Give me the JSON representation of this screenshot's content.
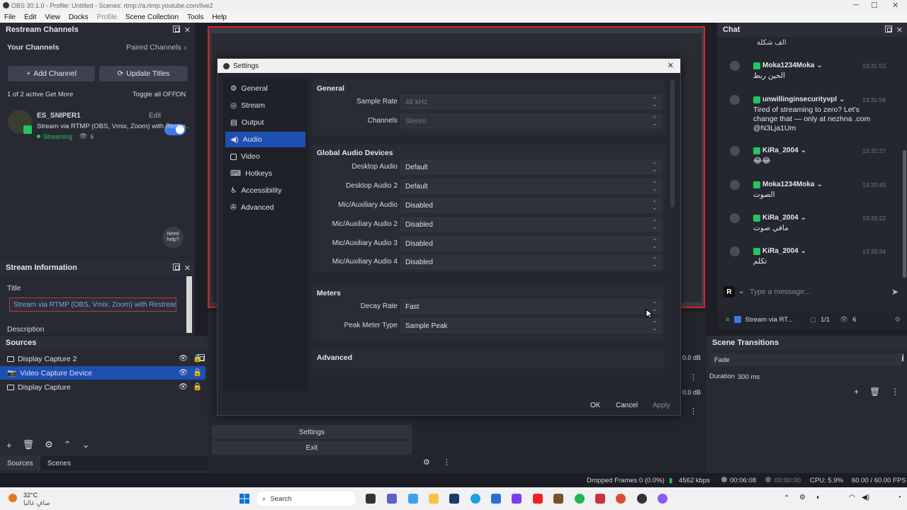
{
  "window": {
    "title": "OBS 30.1.0 - Profile: Untitled - Scenes: rtmp://a.rtmp.youtube.com/live2"
  },
  "menu": [
    "File",
    "Edit",
    "View",
    "Docks",
    "Profile",
    "Scene Collection",
    "Tools",
    "Help"
  ],
  "restream": {
    "header": "Restream Channels",
    "your_channels": "Your Channels",
    "paired_channels": "Paired Channels",
    "add_channel": "Add Channel",
    "update_titles": "Update Titles",
    "active_info": "1 of 2 active Get More",
    "toggle_all": "Toggle all OFF",
    "on": "ON",
    "channel": {
      "name": "ES_SNIPER1",
      "edit": "Edit",
      "desc": "Stream via RTMP (OBS, Vmix, Zoom) with Restre...",
      "status": "Streaming",
      "viewers": "6"
    },
    "help": "Need help?"
  },
  "stream_info": {
    "header": "Stream Information",
    "title_label": "Title",
    "title_value": "Stream via RTMP (OBS, Vmix, Zoom) with Restream",
    "description_label": "Description"
  },
  "sources": {
    "header": "Sources",
    "items": [
      {
        "name": "Display Capture 2"
      },
      {
        "name": "Video Capture Device"
      },
      {
        "name": "Display Capture"
      }
    ],
    "tab_sources": "Sources",
    "tab_scenes": "Scenes"
  },
  "settings": {
    "title": "Settings",
    "nav": [
      "General",
      "Stream",
      "Output",
      "Audio",
      "Video",
      "Hotkeys",
      "Accessibility",
      "Advanced"
    ],
    "active_nav": "Audio",
    "general": {
      "title": "General",
      "sample_rate_label": "Sample Rate",
      "sample_rate": "48 kHz",
      "channels_label": "Channels",
      "channels": "Stereo"
    },
    "global": {
      "title": "Global Audio Devices",
      "rows": [
        {
          "label": "Desktop Audio",
          "value": "Default"
        },
        {
          "label": "Desktop Audio 2",
          "value": "Default"
        },
        {
          "label": "Mic/Auxiliary Audio",
          "value": "Disabled"
        },
        {
          "label": "Mic/Auxiliary Audio 2",
          "value": "Disabled"
        },
        {
          "label": "Mic/Auxiliary Audio 3",
          "value": "Disabled"
        },
        {
          "label": "Mic/Auxiliary Audio 4",
          "value": "Disabled"
        }
      ]
    },
    "meters": {
      "title": "Meters",
      "decay_label": "Decay Rate",
      "decay": "Fast",
      "peak_label": "Peak Meter Type",
      "peak": "Sample Peak"
    },
    "advanced": {
      "title": "Advanced"
    },
    "ok": "OK",
    "cancel": "Cancel",
    "apply": "Apply"
  },
  "controls": {
    "settings": "Settings",
    "exit": "Exit"
  },
  "mixer": {
    "db1": "0.0 dB",
    "db2": "0.0 dB"
  },
  "chat": {
    "header": "Chat",
    "top_text": "الف شكلة",
    "messages": [
      {
        "name": "Moka1234Moka",
        "time": "13:31:53",
        "text": "الحين ربط"
      },
      {
        "name": "unwillinginsecurityvpl",
        "time": "13:31:56",
        "text": "Tired of streaming to zero? Let's change that — only at nezhna .com @N3Lja1Um"
      },
      {
        "name": "KiRa_2004",
        "time": "13:32:27",
        "text": "😂😂"
      },
      {
        "name": "Moka1234Moka",
        "time": "13:32:45",
        "text": "الصوت"
      },
      {
        "name": "KiRa_2004",
        "time": "13:33:22",
        "text": "مافي صوت"
      },
      {
        "name": "KiRa_2004",
        "time": "13:33:34",
        "text": "تكلم"
      }
    ],
    "avatar_letter": "R",
    "placeholder": "Type a message...",
    "stream_label": "Stream via RT...",
    "count": "1/1",
    "viewers": "6"
  },
  "transitions": {
    "header": "Scene Transitions",
    "value": "Fade",
    "duration_label": "Duration",
    "duration": "300 ms"
  },
  "status": {
    "dropped": "Dropped Frames 0 (0.0%)",
    "kbps": "4562 kbps",
    "live_time": "00:06:08",
    "rec_time": "00:00:00",
    "cpu": "CPU: 5.9%",
    "fps": "60.00 / 60.00 FPS"
  },
  "taskbar": {
    "weather_temp": "32°C",
    "weather_desc": "صافٍ غالبا",
    "search": "Search"
  }
}
